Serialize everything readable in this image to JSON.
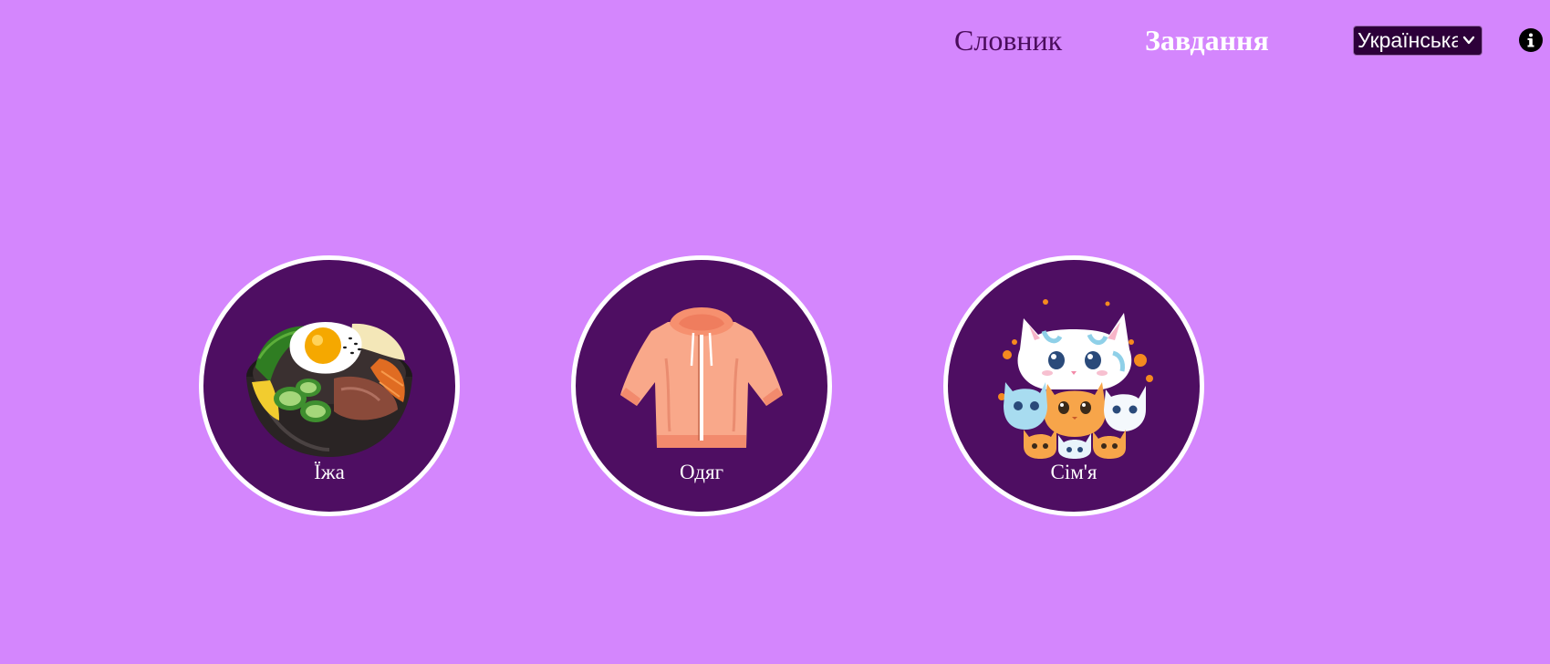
{
  "nav": {
    "dictionary": "Словник",
    "tasks": "Завдання",
    "active": "tasks"
  },
  "language": {
    "selected": "Українська",
    "icon": "chevron-down-icon"
  },
  "info": {
    "icon": "info-icon"
  },
  "categories": [
    {
      "label": "Їжа",
      "icon": "bibimbap-bowl-icon"
    },
    {
      "label": "Одяг",
      "icon": "hoodie-icon"
    },
    {
      "label": "Сім'я",
      "icon": "cat-family-icon"
    }
  ],
  "colors": {
    "background": "#d486fd",
    "circle": "#4e0e62",
    "circle_border": "#ffffff",
    "nav_inactive": "#4a0c5c",
    "nav_active": "#ffffff",
    "select_bg": "#2d0039"
  }
}
